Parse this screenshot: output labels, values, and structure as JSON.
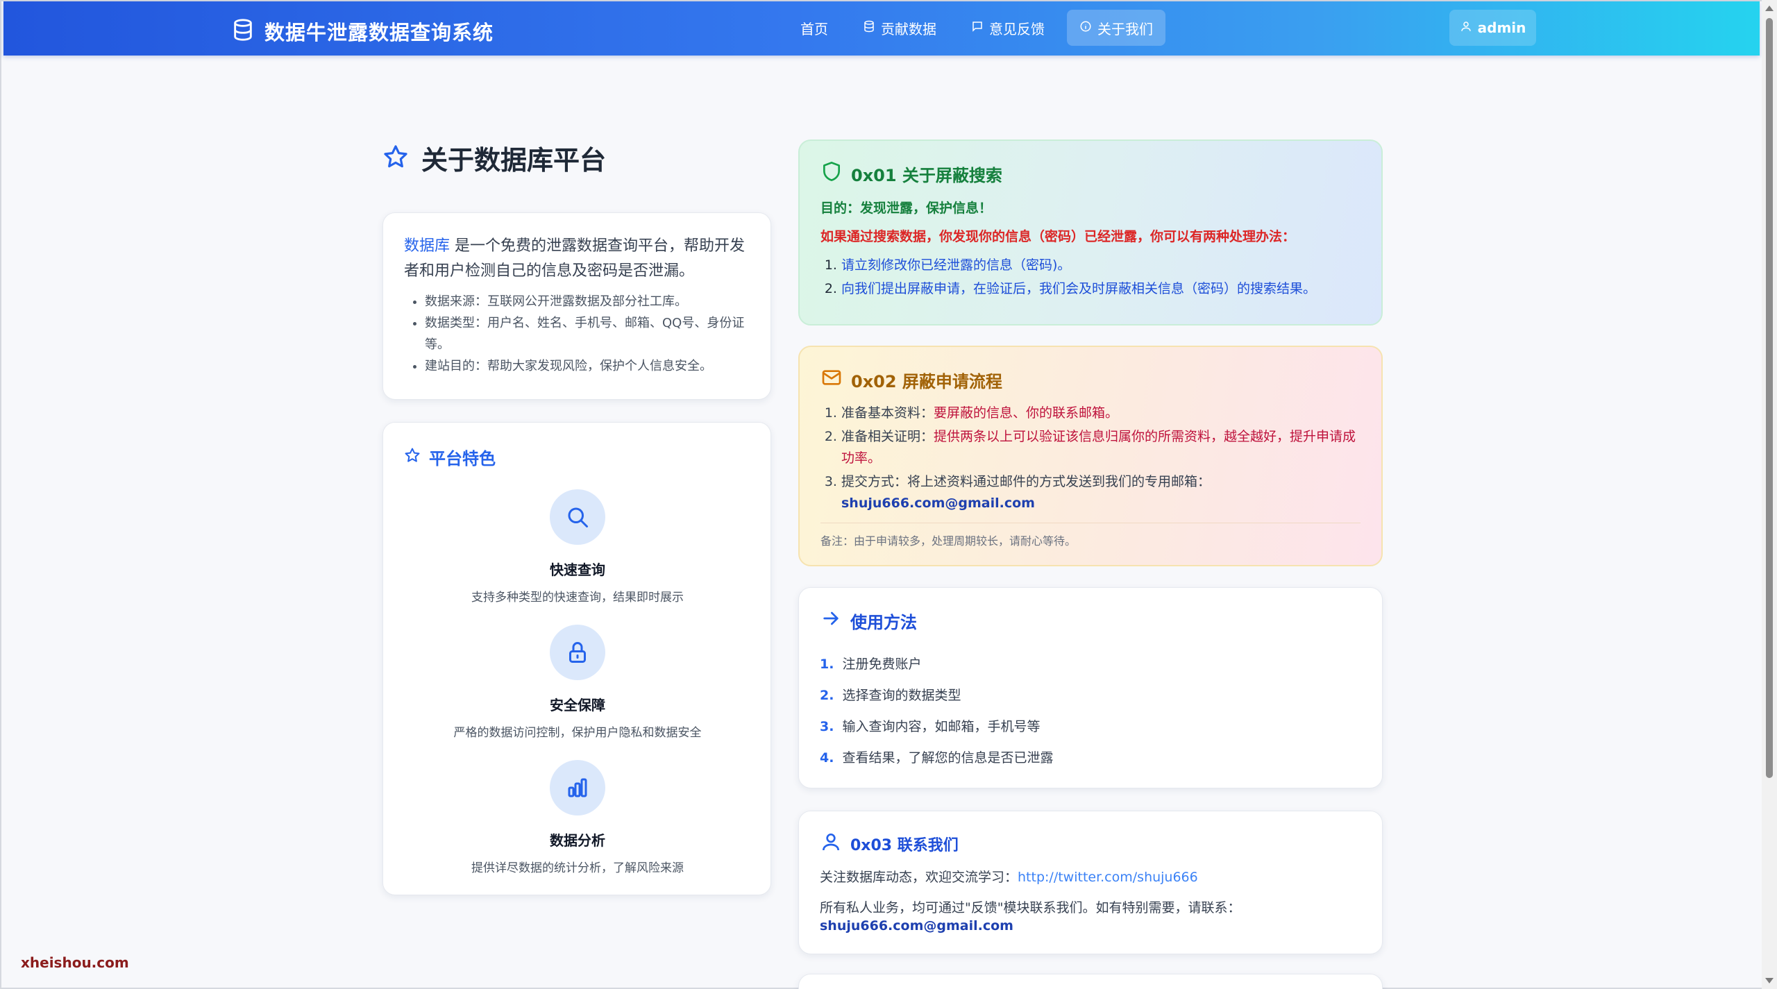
{
  "navbar": {
    "brand": "数据牛泄露数据查询系统",
    "links": [
      {
        "label": "首页",
        "icon": ""
      },
      {
        "label": "贡献数据",
        "icon": "database-icon"
      },
      {
        "label": "意见反馈",
        "icon": "message-icon"
      },
      {
        "label": "关于我们",
        "icon": "info-icon",
        "active": true
      }
    ],
    "user": "admin"
  },
  "page": {
    "title": "关于数据库平台"
  },
  "intro": {
    "highlight": "数据库",
    "text": " 是一个免费的泄露数据查询平台，帮助开发者和用户检测自己的信息及密码是否泄漏。",
    "bullets": [
      "数据来源：互联网公开泄露数据及部分社工库。",
      "数据类型：用户名、姓名、手机号、邮箱、QQ号、身份证等。",
      "建站目的：帮助大家发现风险，保护个人信息安全。"
    ]
  },
  "features": {
    "title": "平台特色",
    "items": [
      {
        "name": "快速查询",
        "desc": "支持多种类型的快速查询，结果即时展示",
        "icon": "search-icon"
      },
      {
        "name": "安全保障",
        "desc": "严格的数据访问控制，保护用户隐私和数据安全",
        "icon": "lock-icon"
      },
      {
        "name": "数据分析",
        "desc": "提供详尽数据的统计分析，了解风险来源",
        "icon": "bar-chart-icon"
      }
    ]
  },
  "shield": {
    "title": "0x01 关于屏蔽搜索",
    "purpose": "目的：发现泄露，保护信息！",
    "warning": "如果通过搜索数据，你发现你的信息（密码）已经泄露，你可以有两种处理办法：",
    "options": [
      "请立刻修改你已经泄露的信息（密码)。",
      "向我们提出屏蔽申请，在验证后，我们会及时屏蔽相关信息（密码）的搜索结果。"
    ]
  },
  "apply": {
    "title": "0x02 屏蔽申请流程",
    "step1_label": "准备基本资料：",
    "step1_em": "要屏蔽的信息、你的联系邮箱。",
    "step2_label": "准备相关证明：",
    "step2_em": "提供两条以上可以验证该信息归属你的所需资料，越全越好，提升申请成功率。",
    "step3_label": "提交方式：将上述资料通过邮件的方式发送到我们的专用邮箱：",
    "step3_mail": "shuju666.com@gmail.com",
    "note": "备注：由于申请较多，处理周期较长，请耐心等待。"
  },
  "usage": {
    "title": "使用方法",
    "steps": [
      {
        "n": "1.",
        "text": "注册免费账户"
      },
      {
        "n": "2.",
        "text": "选择查询的数据类型"
      },
      {
        "n": "3.",
        "text": "输入查询内容，如邮箱，手机号等"
      },
      {
        "n": "4.",
        "text": "查看结果，了解您的信息是否已泄露"
      }
    ]
  },
  "contact": {
    "title": "0x03 联系我们",
    "follow": "关注数据库动态，欢迎交流学习：",
    "twitter": "http://twitter.com/shuju666",
    "private": "所有私人业务，均可通过\"反馈\"模块联系我们。如有特别需要，请联系：",
    "mail": "shuju666.com@gmail.com"
  },
  "watermark": "xheishou.com",
  "colors": {
    "primary": "#2563eb",
    "green": "#15803d",
    "red": "#dc2626",
    "amber": "#a16207"
  }
}
